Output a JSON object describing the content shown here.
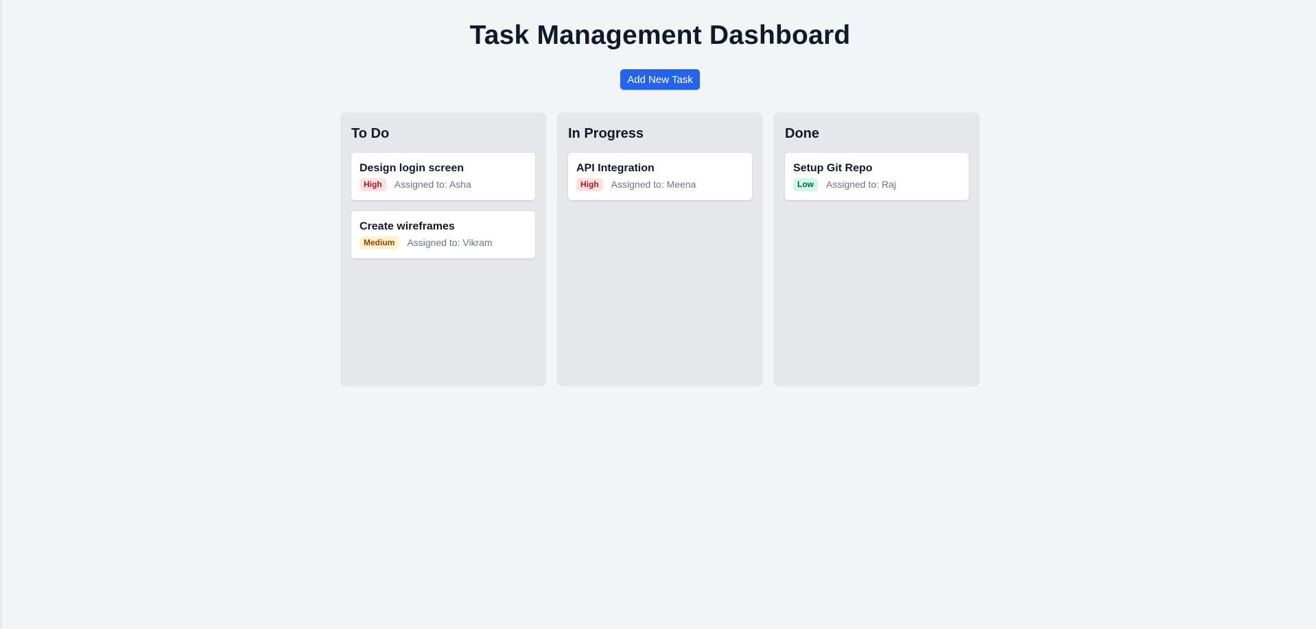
{
  "header": {
    "title": "Task Management Dashboard",
    "add_button_label": "Add New Task"
  },
  "columns": [
    {
      "title": "To Do",
      "cards": [
        {
          "title": "Design login screen",
          "priority": "High",
          "assignee": "Assigned to: Asha"
        },
        {
          "title": "Create wireframes",
          "priority": "Medium",
          "assignee": "Assigned to: Vikram"
        }
      ]
    },
    {
      "title": "In Progress",
      "cards": [
        {
          "title": "API Integration",
          "priority": "High",
          "assignee": "Assigned to: Meena"
        }
      ]
    },
    {
      "title": "Done",
      "cards": [
        {
          "title": "Setup Git Repo",
          "priority": "Low",
          "assignee": "Assigned to: Raj"
        }
      ]
    }
  ],
  "colors": {
    "accent": "#2563eb",
    "background": "#f3f4f6",
    "column_bg": "#e5e7eb",
    "high_bg": "#fee2e2",
    "high_text": "#991b1b",
    "medium_bg": "#fef3c7",
    "medium_text": "#92400e",
    "low_bg": "#d1fae5",
    "low_text": "#065f46"
  }
}
